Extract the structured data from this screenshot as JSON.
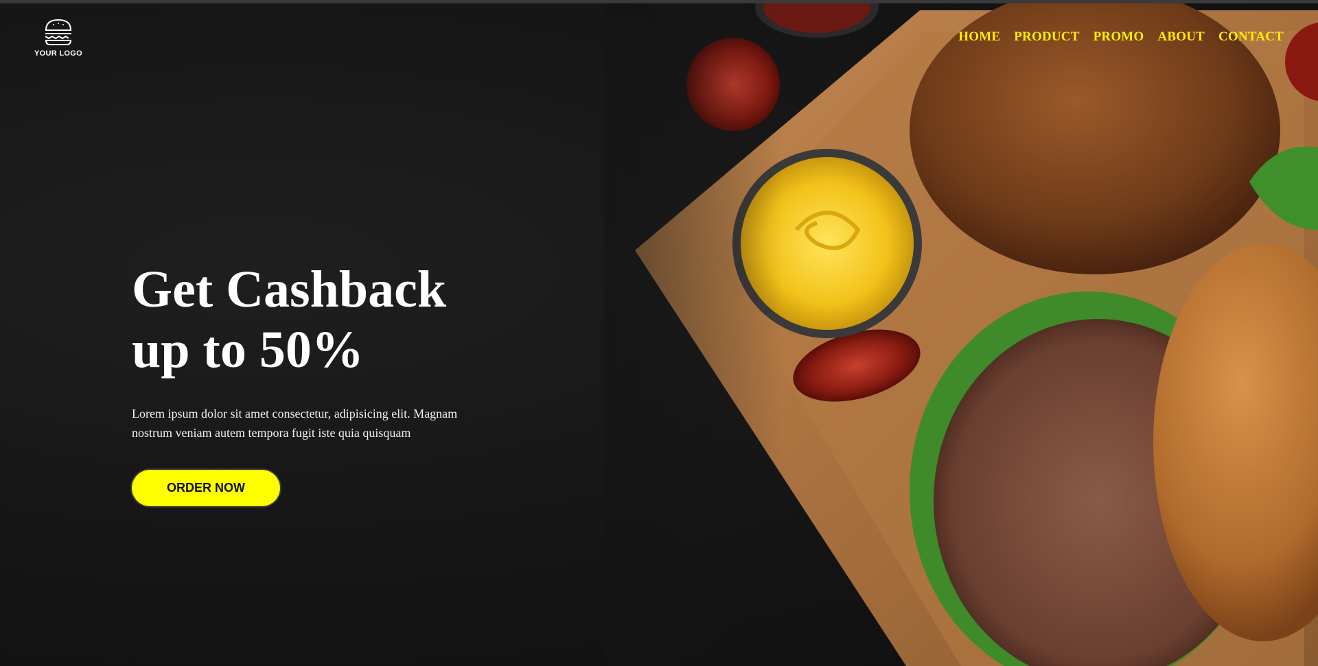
{
  "brand": {
    "logo_text": "YOUR LOGO",
    "logo_icon": "burger-icon"
  },
  "nav": {
    "items": [
      {
        "label": "HOME"
      },
      {
        "label": "PRODUCT"
      },
      {
        "label": "PROMO"
      },
      {
        "label": "ABOUT"
      },
      {
        "label": "CONTACT"
      }
    ]
  },
  "hero": {
    "title_line1": "Get Cashback",
    "title_line2": "up to 50%",
    "description": "Lorem ipsum dolor sit amet consectetur, adipisicing elit. Magnam nostrum veniam autem tempora fugit iste quia quisquam",
    "cta_label": "ORDER NOW",
    "image_subject": "burgers-on-cutting-board"
  },
  "colors": {
    "accent": "#ffff00",
    "nav_link": "#ffee00",
    "background": "#161616",
    "text": "#ffffff"
  }
}
